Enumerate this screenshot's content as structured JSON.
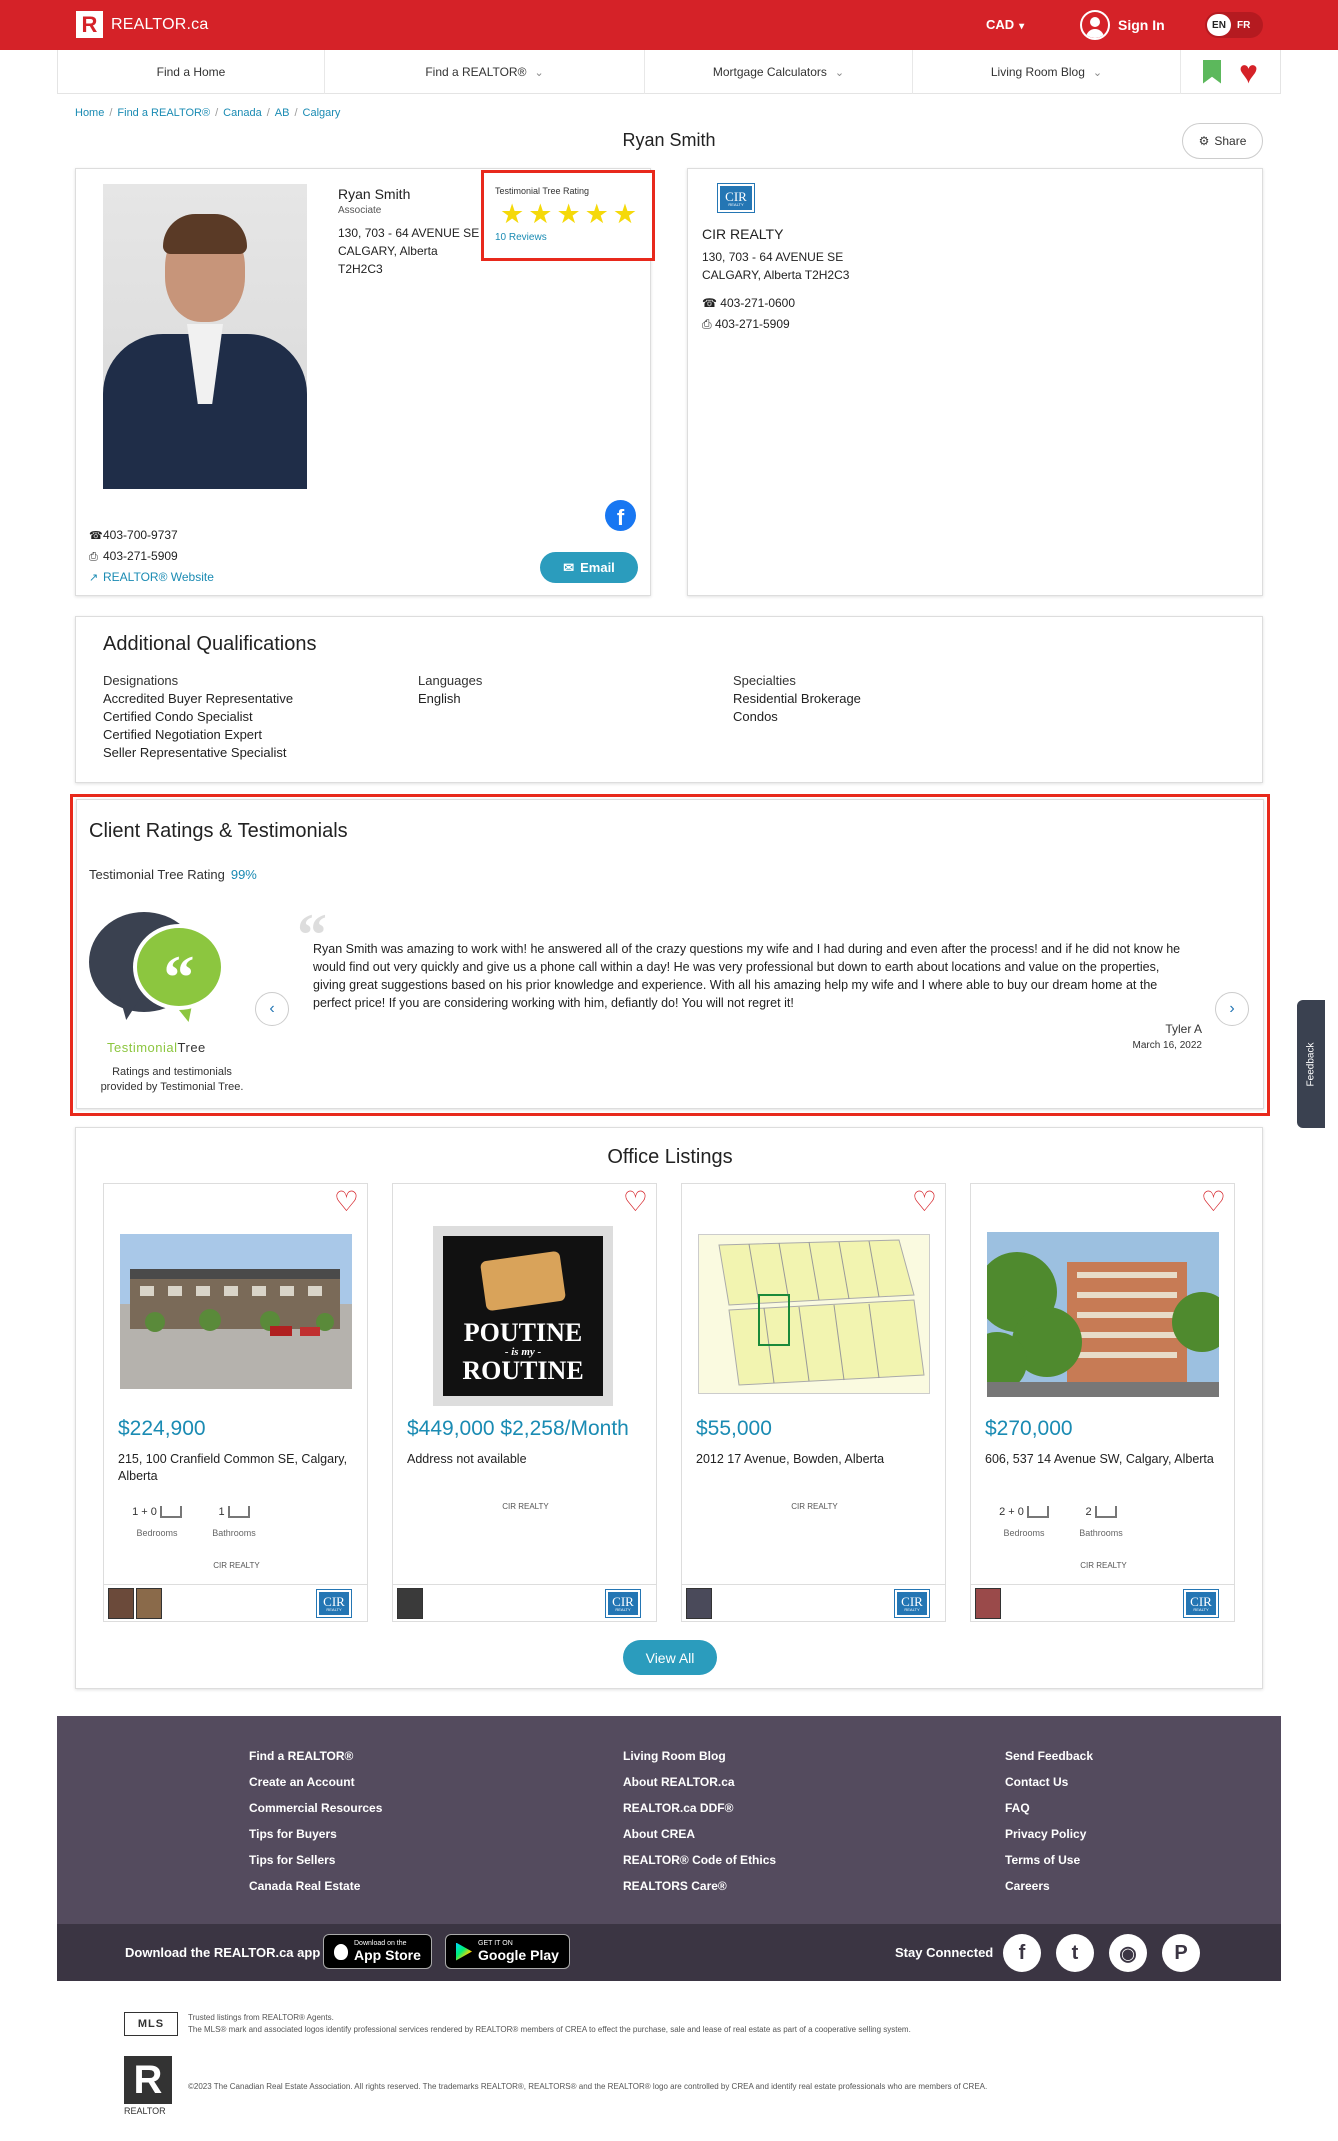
{
  "header": {
    "logo_text": "REALTOR.ca",
    "currency": "CAD",
    "sign_in": "Sign In",
    "lang_en": "EN",
    "lang_fr": "FR",
    "brand_color": "#d52228"
  },
  "nav": {
    "items": [
      {
        "label": "Find a Home"
      },
      {
        "label": "Find a REALTOR®"
      },
      {
        "label": "Mortgage Calculators"
      },
      {
        "label": "Living Room Blog"
      }
    ]
  },
  "breadcrumb": [
    "Home",
    "Find a REALTOR®",
    "Canada",
    "AB",
    "Calgary"
  ],
  "page": {
    "title": "Ryan Smith",
    "share": "Share"
  },
  "agent": {
    "name": "Ryan Smith",
    "role": "Associate",
    "address_line1": "130, 703 - 64 AVENUE SE",
    "address_line2": "CALGARY, Alberta",
    "address_line3": "T2H2C3",
    "rating_label": "Testimonial Tree Rating",
    "stars": 5,
    "reviews": "10 Reviews",
    "phone": "403-700-9737",
    "fax": "403-271-5909",
    "website": "REALTOR® Website",
    "email_button": "Email"
  },
  "office": {
    "logo_text": "CIR",
    "logo_sub": "REALTY",
    "name": "CIR REALTY",
    "address_line1": "130, 703 - 64 AVENUE SE",
    "address_line2": "CALGARY, Alberta T2H2C3",
    "phone": "403-271-0600",
    "fax": "403-271-5909"
  },
  "qualifications": {
    "title": "Additional Qualifications",
    "designations_head": "Designations",
    "designations": [
      "Accredited Buyer Representative",
      "Certified Condo Specialist",
      "Certified Negotiation Expert",
      "Seller Representative Specialist"
    ],
    "languages_head": "Languages",
    "languages": [
      "English"
    ],
    "specialties_head": "Specialties",
    "specialties": [
      "Residential Brokerage",
      "Condos"
    ]
  },
  "testimonials": {
    "title": "Client Ratings & Testimonials",
    "rating_label": "Testimonial Tree Rating",
    "rating_pct": "99%",
    "brand_green": "Testimonial",
    "brand_dark": "Tree",
    "caption_line1": "Ratings and testimonials",
    "caption_line2": "provided by Testimonial Tree.",
    "quote": "Ryan Smith was amazing to work with! he answered all of the crazy questions my wife and I had during and even after the process! and if he did not know he would find out very quickly and give us a phone call within a day! He was very professional but down to earth about locations and value on the properties, giving great suggestions based on his prior knowledge and experience. With all his amazing help my wife and I where able to buy our dream home at the perfect price! If you are considering working with him, defiantly do! You will not regret it!",
    "author": "Tyler A",
    "date": "March 16, 2022"
  },
  "feedback": "Feedback",
  "listings": {
    "title": "Office Listings",
    "view_all": "View All",
    "items": [
      {
        "price": "$224,900",
        "address": "215, 100 Cranfield Common SE, Calgary, Alberta",
        "bedrooms": "1 + 0",
        "bathrooms": "1",
        "bed_label": "Bedrooms",
        "bath_label": "Bathrooms",
        "brokerage": "CIR REALTY"
      },
      {
        "price": "$449,000 $2,258/Month",
        "address": "Address not available",
        "brokerage": "CIR REALTY",
        "image_text_1": "POUTINE",
        "image_text_2": "- is my -",
        "image_text_3": "ROUTINE"
      },
      {
        "price": "$55,000",
        "address": "2012 17 Avenue, Bowden, Alberta",
        "brokerage": "CIR REALTY"
      },
      {
        "price": "$270,000",
        "address": "606, 537 14 Avenue SW, Calgary, Alberta",
        "bedrooms": "2 + 0",
        "bathrooms": "2",
        "bed_label": "Bedrooms",
        "bath_label": "Bathrooms",
        "brokerage": "CIR REALTY"
      }
    ]
  },
  "footer": {
    "col1": [
      "Find a REALTOR®",
      "Create an Account",
      "Commercial Resources",
      "Tips for Buyers",
      "Tips for Sellers",
      "Canada Real Estate"
    ],
    "col2": [
      "Living Room Blog",
      "About REALTOR.ca",
      "REALTOR.ca DDF®",
      "About CREA",
      "REALTOR® Code of Ethics",
      "REALTORS Care®"
    ],
    "col3": [
      "Send Feedback",
      "Contact Us",
      "FAQ",
      "Privacy Policy",
      "Terms of Use",
      "Careers"
    ],
    "download": "Download the REALTOR.ca app",
    "app_store_small": "Download on the",
    "app_store": "App Store",
    "google_small": "GET IT ON",
    "google": "Google Play",
    "stay_connected": "Stay Connected",
    "legal_line1": "Trusted listings from REALTOR® Agents.",
    "legal_line2": "The MLS® mark and associated logos identify professional services rendered by REALTOR® members of CREA to effect the purchase, sale and lease of real estate as part of a cooperative selling system.",
    "legal_line3": "©2023 The Canadian Real Estate Association. All rights reserved. The trademarks REALTOR®, REALTORS® and the REALTOR® logo are controlled by CREA and identify real estate professionals who are members of CREA.",
    "mls_text": "MLS",
    "r_text": "REALTOR"
  }
}
